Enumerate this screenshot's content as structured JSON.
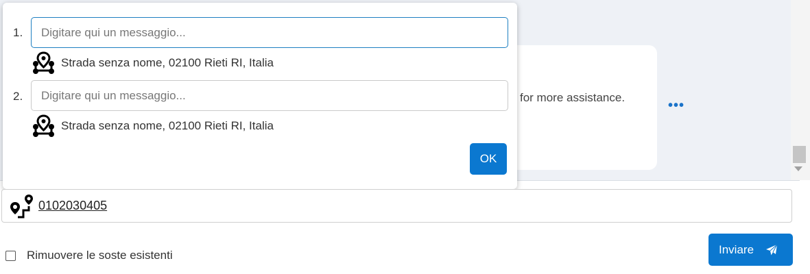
{
  "chat": {
    "bubble_text": "for more assistance.",
    "more_label": "•••"
  },
  "dialog": {
    "stops": [
      {
        "number": "1.",
        "input_placeholder": "Digitare qui un messaggio...",
        "input_value": "",
        "address": "Strada senza nome, 02100 Rieti RI, Italia",
        "icon": "location-pin-network-icon"
      },
      {
        "number": "2.",
        "input_placeholder": "Digitare qui un messaggio...",
        "input_value": "",
        "address": "Strada senza nome, 02100 Rieti RI, Italia",
        "icon": "location-pin-network-icon"
      }
    ],
    "ok_label": "OK"
  },
  "route": {
    "icon": "route-pin-icon",
    "value": "0102030405"
  },
  "options": {
    "remove_stops_label": "Rimuovere le soste esistenti",
    "remove_stops_checked": false
  },
  "send": {
    "label": "Inviare",
    "icon": "paper-plane-icon"
  },
  "colors": {
    "accent": "#0b78d0",
    "chat_background": "#eef1f6",
    "focus_border": "#1d7fc1"
  }
}
